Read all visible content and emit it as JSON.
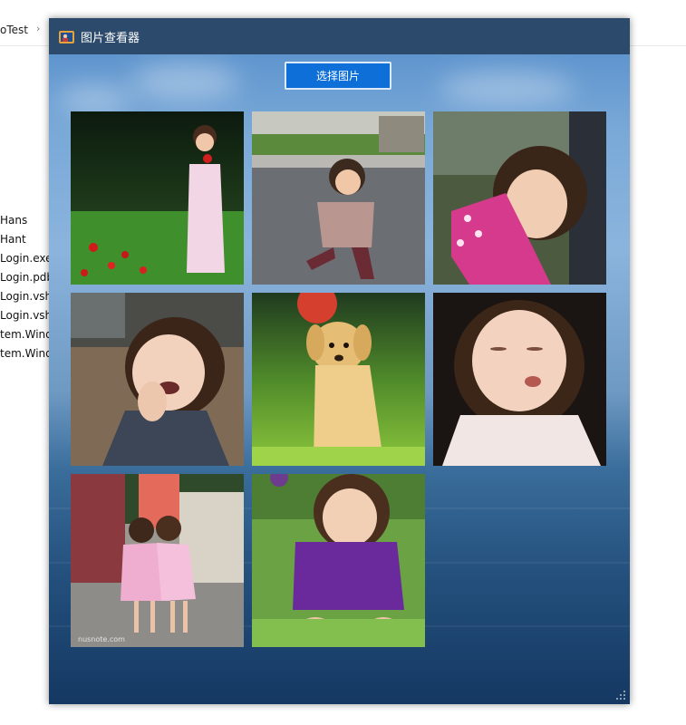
{
  "explorer": {
    "breadcrumb": "oTest",
    "files": [
      "Hans",
      "Hant",
      "Login.exe",
      "Login.pdb",
      "Login.vsho",
      "Login.vsho",
      "tem.Windo",
      "tem.Windo"
    ]
  },
  "window": {
    "title": "图片查看器",
    "select_button": "选择图片"
  },
  "gallery": {
    "watermark": "nusnote.com"
  },
  "colors": {
    "titlebar": "#2c4a6c",
    "button": "#0f6fd8",
    "sky": "#7aa9d8",
    "sea": "#1b4570"
  }
}
